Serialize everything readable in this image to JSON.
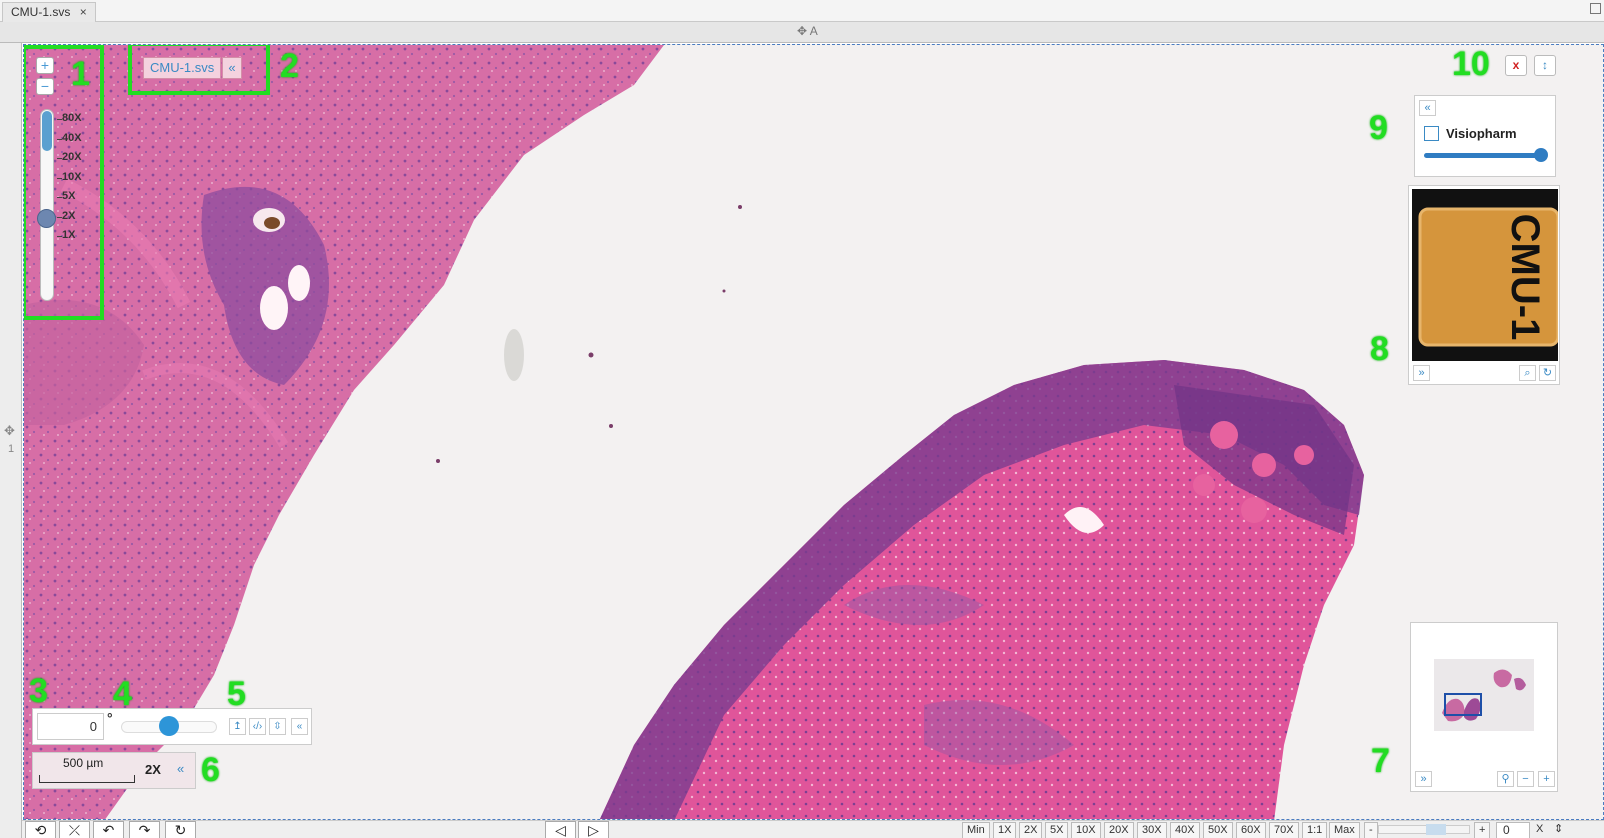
{
  "tab": {
    "title": "CMU-1.svs",
    "close": "×"
  },
  "header": {
    "move_label": "✥ A"
  },
  "leftstrip": {
    "move_icon": "✥",
    "index": "1"
  },
  "zoom_panel": {
    "zoom_in": "+",
    "zoom_out": "−",
    "levels": [
      "80X",
      "40X",
      "20X",
      "10X",
      "5X",
      "2X",
      "1X"
    ],
    "current_level": "2X",
    "level_fraction": 0.45
  },
  "file_label": {
    "name": "CMU-1.svs",
    "collapse": "«"
  },
  "top_buttons": {
    "close": "x",
    "expand": "↕"
  },
  "layers": {
    "collapse": "«",
    "name": "Visiopharm",
    "checked": false,
    "opacity": 1.0
  },
  "slide_label": {
    "text": "CMU-1",
    "expand": "»",
    "zoom": "⌕",
    "rotate": "↻"
  },
  "navigator": {
    "expand": "»",
    "pin": "⚲",
    "zoom_out": "−",
    "zoom_in": "+"
  },
  "rotation": {
    "value": "0",
    "degree": "°",
    "reset": "↥",
    "flip": "‹/›",
    "swap": "⇳",
    "collapse": "«"
  },
  "scale": {
    "bar": "500 µm",
    "mag": "2X",
    "collapse": "«"
  },
  "callouts": [
    "1",
    "2",
    "3",
    "4",
    "5",
    "6",
    "7",
    "8",
    "9",
    "10"
  ],
  "toolbar": {
    "tools": [
      "⟲",
      "⤫",
      "↶",
      "↷",
      "↻"
    ],
    "prev": "◁",
    "next": "▷",
    "magnifications": [
      "Min",
      "1X",
      "2X",
      "5X",
      "10X",
      "20X",
      "30X",
      "40X",
      "50X",
      "60X",
      "70X",
      "1:1",
      "Max"
    ],
    "minus": "-",
    "plus": "+",
    "field_value": "0",
    "clear": "X",
    "spin": "⇕"
  },
  "colors": {
    "callout": "#22dd22",
    "accent": "#3a8ac4",
    "tissue": "#d4549a",
    "tissue_dark": "#7a3b8f"
  }
}
